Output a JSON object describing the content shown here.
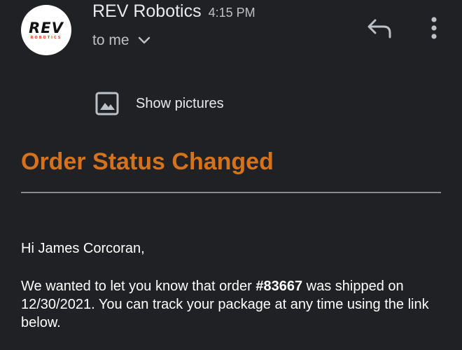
{
  "header": {
    "avatar": {
      "logo_main": "REV",
      "logo_sub": "ROBOTICS",
      "accent_color": "#e0421b"
    },
    "sender_name": "REV Robotics",
    "sent_time": "4:15 PM",
    "recipient_text": "to me",
    "icons": [
      "reply-icon",
      "more-vertical-icon",
      "chevron-down-icon"
    ]
  },
  "show_pictures": {
    "label": "Show pictures",
    "icon": "image-icon"
  },
  "email": {
    "title": "Order Status Changed",
    "title_color": "#d5731d",
    "greeting": "Hi James Corcoran,",
    "body_part1": "We wanted to let you know that order ",
    "order_number": "#83667",
    "body_part2": " was shipped on 12/30/2021.  You can track your package at any time using the link below."
  }
}
